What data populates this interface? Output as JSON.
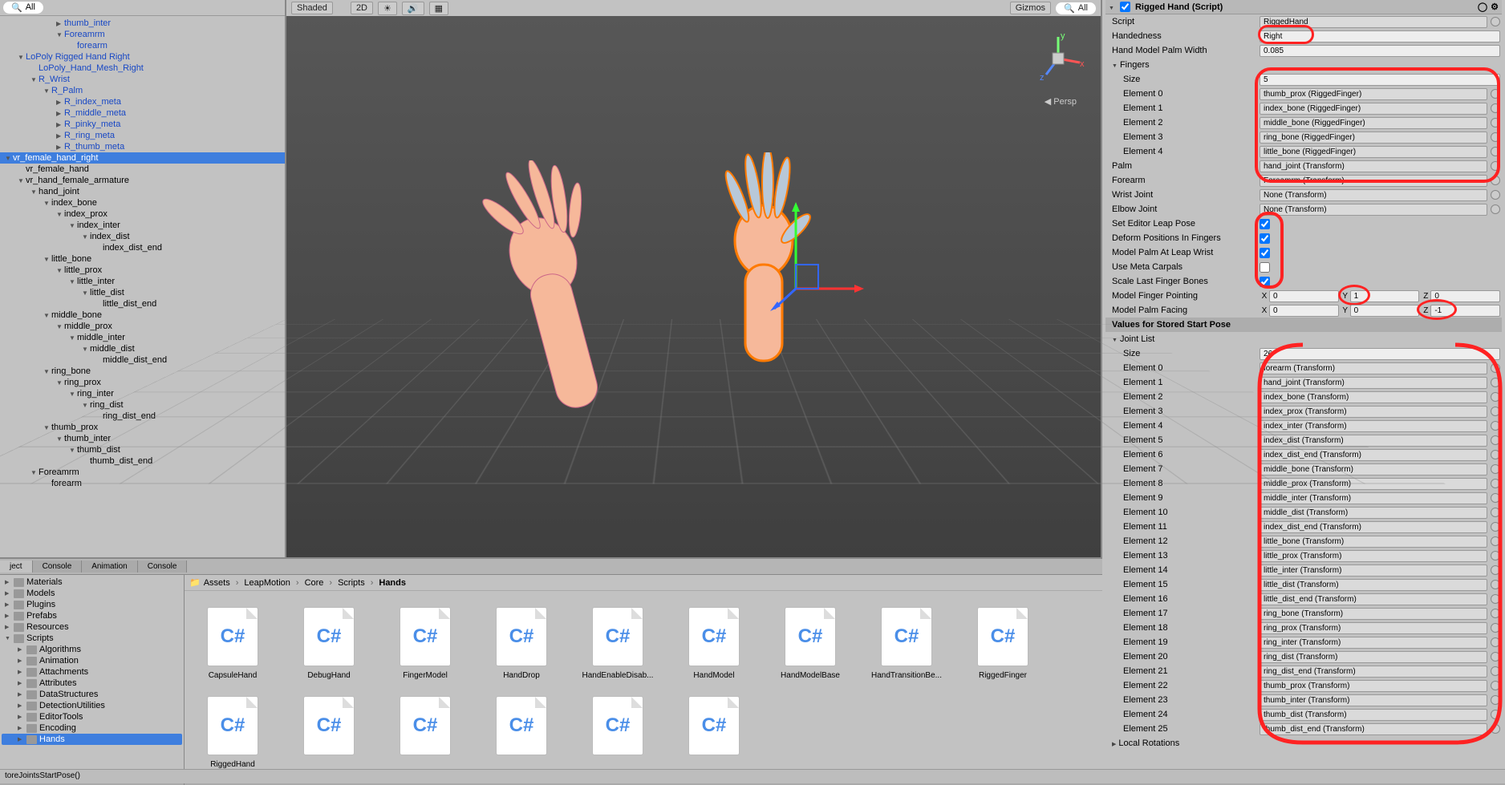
{
  "hierarchy": {
    "search": "All",
    "items": [
      {
        "d": 4,
        "t": "thumb_inter",
        "blue": 1,
        "a": "c"
      },
      {
        "d": 4,
        "t": "Foreamrm",
        "blue": 1,
        "a": "o"
      },
      {
        "d": 5,
        "t": "forearm",
        "blue": 1
      },
      {
        "d": 1,
        "t": "LoPoly Rigged Hand Right",
        "blue": 1,
        "a": "o"
      },
      {
        "d": 2,
        "t": "LoPoly_Hand_Mesh_Right",
        "blue": 1
      },
      {
        "d": 2,
        "t": "R_Wrist",
        "blue": 1,
        "a": "o"
      },
      {
        "d": 3,
        "t": "R_Palm",
        "blue": 1,
        "a": "o"
      },
      {
        "d": 4,
        "t": "R_index_meta",
        "blue": 1,
        "a": "c"
      },
      {
        "d": 4,
        "t": "R_middle_meta",
        "blue": 1,
        "a": "c"
      },
      {
        "d": 4,
        "t": "R_pinky_meta",
        "blue": 1,
        "a": "c"
      },
      {
        "d": 4,
        "t": "R_ring_meta",
        "blue": 1,
        "a": "c"
      },
      {
        "d": 4,
        "t": "R_thumb_meta",
        "blue": 1,
        "a": "c"
      },
      {
        "d": 0,
        "t": "vr_female_hand_right",
        "sel": 1,
        "a": "o"
      },
      {
        "d": 1,
        "t": "vr_female_hand"
      },
      {
        "d": 1,
        "t": "vr_hand_female_armature",
        "a": "o"
      },
      {
        "d": 2,
        "t": "hand_joint",
        "a": "o"
      },
      {
        "d": 3,
        "t": "index_bone",
        "a": "o"
      },
      {
        "d": 4,
        "t": "index_prox",
        "a": "o"
      },
      {
        "d": 5,
        "t": "index_inter",
        "a": "o"
      },
      {
        "d": 6,
        "t": "index_dist",
        "a": "o"
      },
      {
        "d": 7,
        "t": "index_dist_end"
      },
      {
        "d": 3,
        "t": "little_bone",
        "a": "o"
      },
      {
        "d": 4,
        "t": "little_prox",
        "a": "o"
      },
      {
        "d": 5,
        "t": "little_inter",
        "a": "o"
      },
      {
        "d": 6,
        "t": "little_dist",
        "a": "o"
      },
      {
        "d": 7,
        "t": "little_dist_end"
      },
      {
        "d": 3,
        "t": "middle_bone",
        "a": "o"
      },
      {
        "d": 4,
        "t": "middle_prox",
        "a": "o"
      },
      {
        "d": 5,
        "t": "middle_inter",
        "a": "o"
      },
      {
        "d": 6,
        "t": "middle_dist",
        "a": "o"
      },
      {
        "d": 7,
        "t": "middle_dist_end"
      },
      {
        "d": 3,
        "t": "ring_bone",
        "a": "o"
      },
      {
        "d": 4,
        "t": "ring_prox",
        "a": "o"
      },
      {
        "d": 5,
        "t": "ring_inter",
        "a": "o"
      },
      {
        "d": 6,
        "t": "ring_dist",
        "a": "o"
      },
      {
        "d": 7,
        "t": "ring_dist_end"
      },
      {
        "d": 3,
        "t": "thumb_prox",
        "a": "o"
      },
      {
        "d": 4,
        "t": "thumb_inter",
        "a": "o"
      },
      {
        "d": 5,
        "t": "thumb_dist",
        "a": "o"
      },
      {
        "d": 6,
        "t": "thumb_dist_end"
      },
      {
        "d": 2,
        "t": "Foreamrm",
        "a": "o"
      },
      {
        "d": 3,
        "t": "forearm"
      }
    ]
  },
  "viewport": {
    "shading": "Shaded",
    "mode2d": "2D",
    "gizmos": "Gizmos",
    "search": "All",
    "persp": "Persp"
  },
  "project": {
    "tabs": [
      "ject",
      "Console",
      "Animation",
      "Console"
    ],
    "activeTab": 0,
    "folders": [
      {
        "d": 0,
        "t": "Materials"
      },
      {
        "d": 0,
        "t": "Models"
      },
      {
        "d": 0,
        "t": "Plugins"
      },
      {
        "d": 0,
        "t": "Prefabs"
      },
      {
        "d": 0,
        "t": "Resources"
      },
      {
        "d": 0,
        "t": "Scripts",
        "open": 1
      },
      {
        "d": 1,
        "t": "Algorithms"
      },
      {
        "d": 1,
        "t": "Animation"
      },
      {
        "d": 1,
        "t": "Attachments"
      },
      {
        "d": 1,
        "t": "Attributes"
      },
      {
        "d": 1,
        "t": "DataStructures"
      },
      {
        "d": 1,
        "t": "DetectionUtilities"
      },
      {
        "d": 1,
        "t": "EditorTools"
      },
      {
        "d": 1,
        "t": "Encoding"
      },
      {
        "d": 1,
        "t": "Hands",
        "sel": 1
      }
    ],
    "breadcrumb": [
      "Assets",
      "LeapMotion",
      "Core",
      "Scripts",
      "Hands"
    ],
    "assets": [
      "CapsuleHand",
      "DebugHand",
      "FingerModel",
      "HandDrop",
      "HandEnableDisab...",
      "HandModel",
      "HandModelBase",
      "HandTransitionBe...",
      "RiggedFinger",
      "RiggedHand",
      "",
      "",
      "",
      "",
      ""
    ]
  },
  "inspector": {
    "component": "Rigged Hand (Script)",
    "script": "RiggedHand",
    "handedness": "Right",
    "palmWidth": "0.085",
    "fingersSize": "5",
    "fingers": [
      {
        "lbl": "Element 0",
        "val": "thumb_prox (RiggedFinger)"
      },
      {
        "lbl": "Element 1",
        "val": "index_bone (RiggedFinger)"
      },
      {
        "lbl": "Element 2",
        "val": "middle_bone (RiggedFinger)"
      },
      {
        "lbl": "Element 3",
        "val": "ring_bone (RiggedFinger)"
      },
      {
        "lbl": "Element 4",
        "val": "little_bone (RiggedFinger)"
      }
    ],
    "palm": "hand_joint (Transform)",
    "forearm": "Foreamrm (Transform)",
    "wristJoint": "None (Transform)",
    "elbowJoint": "None (Transform)",
    "setEditorLeapPose": true,
    "deformPositions": true,
    "modelPalmAtLeapWrist": true,
    "useMetaCarpals": false,
    "scaleLastFingerBones": true,
    "fingerPointing": {
      "x": "0",
      "y": "1",
      "z": "0"
    },
    "palmFacing": {
      "x": "0",
      "y": "0",
      "z": "-1"
    },
    "sectionLabel": "Values for Stored Start Pose",
    "jointSize": "26",
    "joints": [
      "forearm (Transform)",
      "hand_joint (Transform)",
      "index_bone (Transform)",
      "index_prox (Transform)",
      "index_inter (Transform)",
      "index_dist (Transform)",
      "index_dist_end (Transform)",
      "middle_bone (Transform)",
      "middle_prox (Transform)",
      "middle_inter (Transform)",
      "middle_dist (Transform)",
      "index_dist_end (Transform)",
      "little_bone (Transform)",
      "little_prox (Transform)",
      "little_inter (Transform)",
      "little_dist (Transform)",
      "little_dist_end (Transform)",
      "ring_bone (Transform)",
      "ring_prox (Transform)",
      "ring_inter (Transform)",
      "ring_dist (Transform)",
      "ring_dist_end (Transform)",
      "thumb_prox (Transform)",
      "thumb_inter (Transform)",
      "thumb_dist (Transform)",
      "thumb_dist_end (Transform)"
    ],
    "localRotations": "Local Rotations",
    "labels": {
      "script": "Script",
      "handedness": "Handedness",
      "palmWidth": "Hand Model Palm Width",
      "fingers": "Fingers",
      "size": "Size",
      "palm": "Palm",
      "forearm": "Forearm",
      "wrist": "Wrist Joint",
      "elbow": "Elbow Joint",
      "setPose": "Set Editor Leap Pose",
      "deform": "Deform Positions In Fingers",
      "palmWrist": "Model Palm At Leap Wrist",
      "meta": "Use Meta Carpals",
      "scale": "Scale Last Finger Bones",
      "fPoint": "Model Finger Pointing",
      "pFace": "Model Palm Facing",
      "jointList": "Joint List"
    }
  },
  "status": "toreJointsStartPose()"
}
